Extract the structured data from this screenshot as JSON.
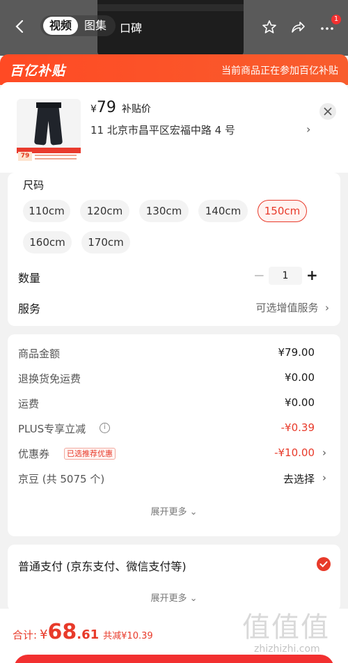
{
  "nav": {
    "tabs": [
      "视频",
      "图集",
      "口碑"
    ],
    "active_tab": "视频",
    "cart_badge": "1"
  },
  "banner": {
    "logo_text": "百亿补贴",
    "notice": "当前商品正在参加百亿补贴"
  },
  "product": {
    "price_symbol": "¥",
    "price": "79",
    "price_label": "补贴价",
    "address": "11  北京市昌平区宏福中路 4 号",
    "thumb_price": "79"
  },
  "spec": {
    "title": "尺码",
    "sizes": [
      "110cm",
      "120cm",
      "130cm",
      "140cm",
      "150cm",
      "160cm",
      "170cm"
    ],
    "selected": "150cm"
  },
  "quantity": {
    "label": "数量",
    "value": "1"
  },
  "service": {
    "label": "服务",
    "value": "可选增值服务"
  },
  "fees": {
    "rows": [
      {
        "label": "商品金额",
        "value": "¥79.00"
      },
      {
        "label": "退换货免运费",
        "value": "¥0.00"
      },
      {
        "label": "运费",
        "value": "¥0.00"
      },
      {
        "label": "PLUS专享立减",
        "value": "-¥0.39"
      },
      {
        "label": "优惠券",
        "value": "-¥10.00",
        "tag": "已选推荐优惠"
      },
      {
        "label": "京豆 (共 5075 个)",
        "value": "去选择"
      }
    ],
    "more": "展开更多"
  },
  "payment": {
    "label": "普通支付 (京东支付、微信支付等)",
    "more": "展开更多"
  },
  "summary": {
    "label": "合计:",
    "symbol": "¥",
    "int": "68",
    "dec": ".61",
    "saved": "共减¥10.39"
  },
  "watermark": {
    "text": "值值值",
    "site": "zhizhizhi.com"
  },
  "colors": {
    "accent": "#e83a2a",
    "banner": "#ff4a24"
  }
}
